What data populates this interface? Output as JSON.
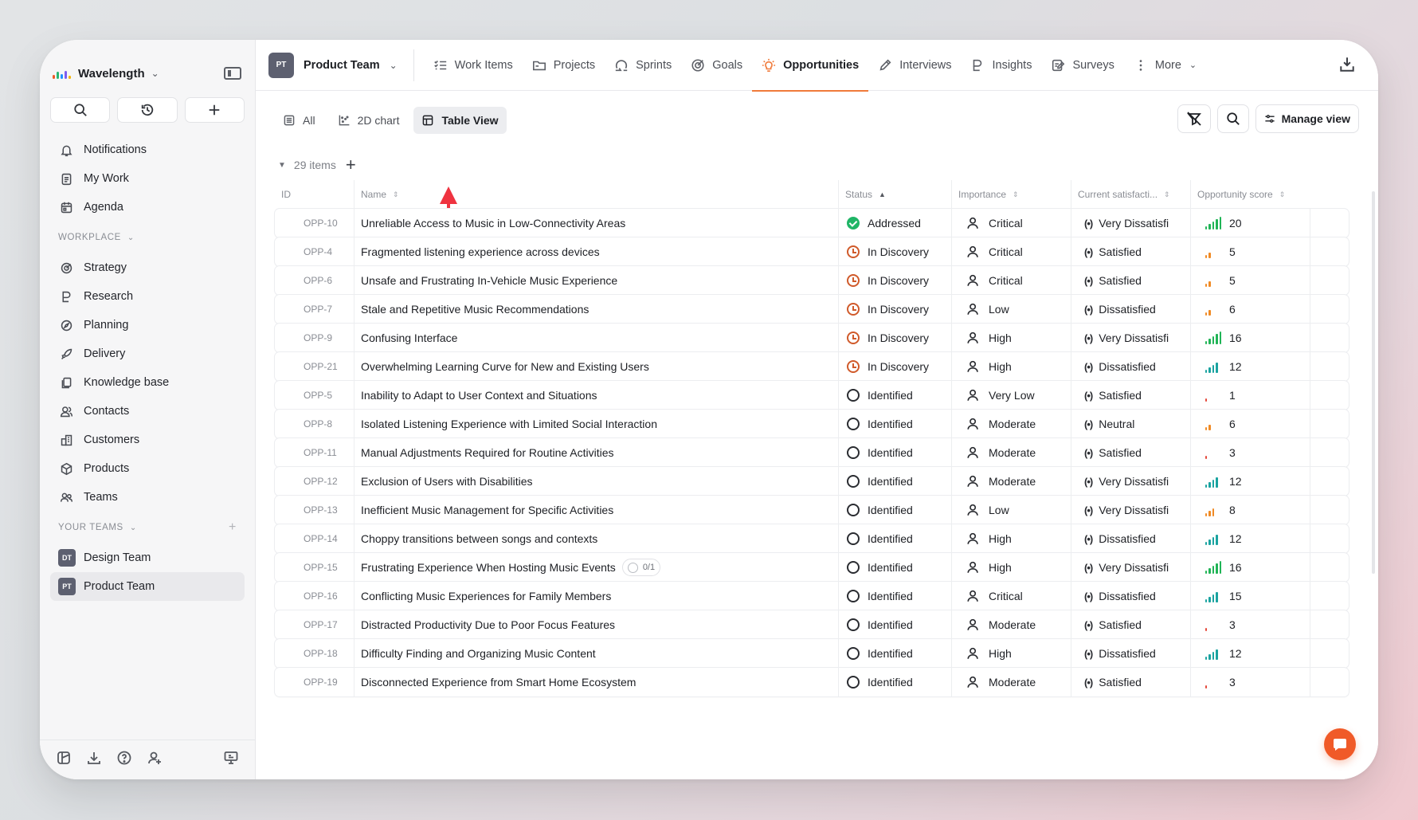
{
  "workspace": {
    "name": "Wavelength"
  },
  "sidebar": {
    "primary": [
      {
        "label": "Notifications",
        "icon": "bell-icon"
      },
      {
        "label": "My Work",
        "icon": "clipboard-icon"
      },
      {
        "label": "Agenda",
        "icon": "calendar-icon"
      }
    ],
    "workplace_label": "WORKPLACE",
    "workplace": [
      {
        "label": "Strategy",
        "icon": "target-icon"
      },
      {
        "label": "Research",
        "icon": "research-icon"
      },
      {
        "label": "Planning",
        "icon": "compass-icon"
      },
      {
        "label": "Delivery",
        "icon": "rocket-icon"
      },
      {
        "label": "Knowledge base",
        "icon": "copy-icon"
      },
      {
        "label": "Contacts",
        "icon": "contacts-icon"
      },
      {
        "label": "Customers",
        "icon": "building-icon"
      },
      {
        "label": "Products",
        "icon": "cube-icon"
      },
      {
        "label": "Teams",
        "icon": "users-icon"
      }
    ],
    "teams_label": "YOUR TEAMS",
    "teams": [
      {
        "badge": "DT",
        "label": "Design Team"
      },
      {
        "badge": "PT",
        "label": "Product Team"
      }
    ]
  },
  "header": {
    "team_badge": "PT",
    "team_name": "Product Team",
    "tabs": [
      {
        "label": "Work Items",
        "icon": "list-check-icon"
      },
      {
        "label": "Projects",
        "icon": "folder-icon"
      },
      {
        "label": "Sprints",
        "icon": "sprint-icon"
      },
      {
        "label": "Goals",
        "icon": "goal-icon"
      },
      {
        "label": "Opportunities",
        "icon": "lightbulb-icon"
      },
      {
        "label": "Interviews",
        "icon": "pen-icon"
      },
      {
        "label": "Insights",
        "icon": "insight-icon"
      },
      {
        "label": "Surveys",
        "icon": "survey-icon"
      },
      {
        "label": "More",
        "icon": "more-vertical-icon"
      }
    ]
  },
  "views": {
    "tabs": [
      {
        "label": "All",
        "icon": "list-icon"
      },
      {
        "label": "2D chart",
        "icon": "scatter-icon"
      },
      {
        "label": "Table View",
        "icon": "table-icon"
      }
    ],
    "manage_label": "Manage view"
  },
  "group": {
    "count_label": "29 items"
  },
  "table": {
    "columns": [
      "ID",
      "Name",
      "Status",
      "Importance",
      "Current satisfacti...",
      "Opportunity score"
    ],
    "colors": {
      "high": "#20b456",
      "mid": "#1aa3a0",
      "low": "#f08a24",
      "minimal": "#e5483a"
    },
    "rows": [
      {
        "id": "OPP-10",
        "name": "Unreliable Access to Music in Low-Connectivity Areas",
        "status": "Addressed",
        "importance": "Critical",
        "satisfaction": "Very Dissatisfi",
        "score": "20"
      },
      {
        "id": "OPP-4",
        "name": "Fragmented listening experience across devices",
        "status": "In Discovery",
        "importance": "Critical",
        "satisfaction": "Satisfied",
        "score": "5"
      },
      {
        "id": "OPP-6",
        "name": "Unsafe and Frustrating In-Vehicle Music Experience",
        "status": "In Discovery",
        "importance": "Critical",
        "satisfaction": "Satisfied",
        "score": "5"
      },
      {
        "id": "OPP-7",
        "name": "Stale and Repetitive Music Recommendations",
        "status": "In Discovery",
        "importance": "Low",
        "satisfaction": "Dissatisfied",
        "score": "6"
      },
      {
        "id": "OPP-9",
        "name": "Confusing Interface",
        "status": "In Discovery",
        "importance": "High",
        "satisfaction": "Very Dissatisfi",
        "score": "16"
      },
      {
        "id": "OPP-21",
        "name": "Overwhelming Learning Curve for New and Existing Users",
        "status": "In Discovery",
        "importance": "High",
        "satisfaction": "Dissatisfied",
        "score": "12"
      },
      {
        "id": "OPP-5",
        "name": "Inability to Adapt to User Context and Situations",
        "status": "Identified",
        "importance": "Very Low",
        "satisfaction": "Satisfied",
        "score": "1"
      },
      {
        "id": "OPP-8",
        "name": "Isolated Listening Experience with Limited Social Interaction",
        "status": "Identified",
        "importance": "Moderate",
        "satisfaction": "Neutral",
        "score": "6"
      },
      {
        "id": "OPP-11",
        "name": "Manual Adjustments Required for Routine Activities",
        "status": "Identified",
        "importance": "Moderate",
        "satisfaction": "Satisfied",
        "score": "3"
      },
      {
        "id": "OPP-12",
        "name": "Exclusion of Users with Disabilities",
        "status": "Identified",
        "importance": "Moderate",
        "satisfaction": "Very Dissatisfi",
        "score": "12"
      },
      {
        "id": "OPP-13",
        "name": "Inefficient Music Management for Specific Activities",
        "status": "Identified",
        "importance": "Low",
        "satisfaction": "Very Dissatisfi",
        "score": "8"
      },
      {
        "id": "OPP-14",
        "name": "Choppy transitions between songs and contexts",
        "status": "Identified",
        "importance": "High",
        "satisfaction": "Dissatisfied",
        "score": "12"
      },
      {
        "id": "OPP-15",
        "name": "Frustrating Experience When Hosting Music Events",
        "status": "Identified",
        "importance": "High",
        "satisfaction": "Very Dissatisfi",
        "score": "16",
        "badge": "0/1"
      },
      {
        "id": "OPP-16",
        "name": "Conflicting Music Experiences for Family Members",
        "status": "Identified",
        "importance": "Critical",
        "satisfaction": "Dissatisfied",
        "score": "15"
      },
      {
        "id": "OPP-17",
        "name": "Distracted Productivity Due to Poor Focus Features",
        "status": "Identified",
        "importance": "Moderate",
        "satisfaction": "Satisfied",
        "score": "3"
      },
      {
        "id": "OPP-18",
        "name": "Difficulty Finding and Organizing Music Content",
        "status": "Identified",
        "importance": "High",
        "satisfaction": "Dissatisfied",
        "score": "12"
      },
      {
        "id": "OPP-19",
        "name": "Disconnected Experience from Smart Home Ecosystem",
        "status": "Identified",
        "importance": "Moderate",
        "satisfaction": "Satisfied",
        "score": "3"
      }
    ]
  }
}
